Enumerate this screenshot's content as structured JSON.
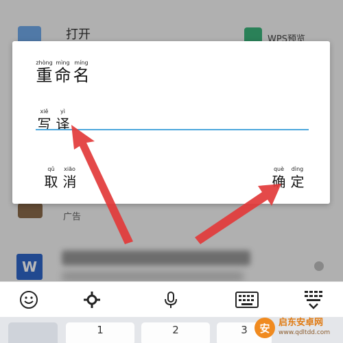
{
  "background": {
    "open_label": "打开",
    "wps_label": "WPS预览",
    "ad_label": "广告",
    "wps_icon_letter": "W"
  },
  "dialog": {
    "title": [
      {
        "py": "zhòng",
        "hz": "重"
      },
      {
        "py": "mìng",
        "hz": "命"
      },
      {
        "py": "míng",
        "hz": "名"
      }
    ],
    "input_value": [
      {
        "py": "xiě",
        "hz": "写"
      },
      {
        "py": "yì",
        "hz": "译"
      }
    ],
    "cancel": [
      {
        "py": "qǔ",
        "hz": "取"
      },
      {
        "py": "xiāo",
        "hz": "消"
      }
    ],
    "confirm": [
      {
        "py": "què",
        "hz": "确"
      },
      {
        "py": "dìng",
        "hz": "定"
      }
    ]
  },
  "keyboard": {
    "toolbar_icons": [
      "emoji-icon",
      "gear-icon",
      "microphone-icon",
      "keyboard-icon",
      "hide-keyboard-icon"
    ],
    "keys": [
      "1",
      "2",
      "3"
    ]
  },
  "watermark": {
    "symbol": "安",
    "name": "启东安卓网",
    "url": "www.qdltdd.com"
  },
  "colors": {
    "accent": "#4aa6dc",
    "arrow": "#e23a3a",
    "wps_blue": "#2e66c8"
  }
}
